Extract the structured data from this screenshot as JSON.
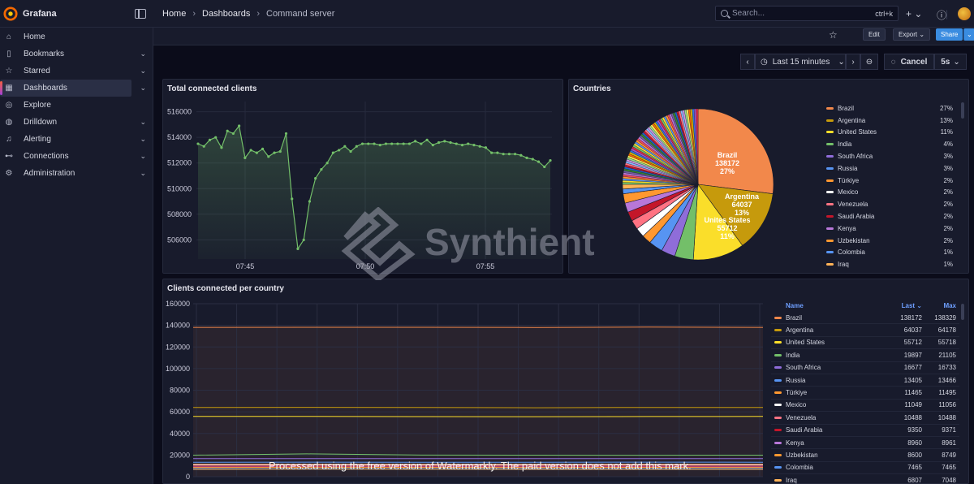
{
  "app": {
    "name": "Grafana"
  },
  "breadcrumb": [
    "Home",
    "Dashboards",
    "Command server"
  ],
  "search": {
    "placeholder": "Search...",
    "shortcut": "ctrl+k"
  },
  "sidebar": {
    "items": [
      {
        "label": "Home",
        "icon": "home-icon",
        "chevron": false
      },
      {
        "label": "Bookmarks",
        "icon": "bookmark-icon",
        "chevron": true
      },
      {
        "label": "Starred",
        "icon": "star-icon",
        "chevron": true
      },
      {
        "label": "Dashboards",
        "icon": "grid-icon",
        "chevron": true,
        "active": true
      },
      {
        "label": "Explore",
        "icon": "compass-icon",
        "chevron": false
      },
      {
        "label": "Drilldown",
        "icon": "drilldown-icon",
        "chevron": true
      },
      {
        "label": "Alerting",
        "icon": "bell-icon",
        "chevron": true
      },
      {
        "label": "Connections",
        "icon": "link-icon",
        "chevron": true
      },
      {
        "label": "Administration",
        "icon": "gear-icon",
        "chevron": true
      }
    ]
  },
  "toolbar": {
    "edit_label": "Edit",
    "export_label": "Export",
    "share_label": "Share"
  },
  "time": {
    "range_label": "Last 15 minutes",
    "cancel_label": "Cancel",
    "refresh_interval": "5s"
  },
  "panels": {
    "total": {
      "title": "Total connected clients"
    },
    "countries": {
      "title": "Countries"
    },
    "per_country": {
      "title": "Clients connected per country"
    }
  },
  "colors": {
    "accent": "#3a8ce0",
    "line_green": "#73bf69",
    "brazil": "#f2884b",
    "argentina": "#c69a0c",
    "united_states": "#fade2a"
  },
  "chart_data": [
    {
      "type": "line",
      "title": "Total connected clients",
      "x_ticks": [
        "07:45",
        "07:50",
        "07:55"
      ],
      "y_ticks": [
        506000,
        508000,
        510000,
        512000,
        514000,
        516000
      ],
      "ylim": [
        504500,
        516800
      ],
      "series": [
        {
          "values": [
            513500,
            513300,
            513800,
            514000,
            513200,
            514500,
            514300,
            514900,
            512400,
            513000,
            512800,
            513100,
            512500,
            512800,
            512900,
            514300,
            509200,
            505300,
            506000,
            509000,
            510800,
            511500,
            512000,
            512800,
            513000,
            513300,
            512900,
            513300,
            513500,
            513500,
            513500,
            513400,
            513500,
            513500,
            513500,
            513500,
            513500,
            513700,
            513500,
            513800,
            513400,
            513600,
            513700,
            513600,
            513500,
            513400,
            513500,
            513400,
            513300,
            513200,
            512800,
            512800,
            512700,
            512700,
            512700,
            512600,
            512400,
            512300,
            512100,
            511700,
            512200
          ]
        }
      ],
      "grid": true
    },
    {
      "type": "pie",
      "title": "Countries",
      "slice_labels": [
        {
          "name": "Brazil",
          "value": "138172",
          "pct": "27%"
        },
        {
          "name": "Argentina",
          "value": "64037",
          "pct": "13%"
        },
        {
          "name": "Unites States",
          "value": "55712",
          "pct": "11%"
        }
      ],
      "legend": [
        {
          "name": "Brazil",
          "pct": "27%",
          "color": "#f2884b"
        },
        {
          "name": "Argentina",
          "pct": "13%",
          "color": "#c69a0c"
        },
        {
          "name": "United States",
          "pct": "11%",
          "color": "#fade2a"
        },
        {
          "name": "India",
          "pct": "4%",
          "color": "#73bf69"
        },
        {
          "name": "South Africa",
          "pct": "3%",
          "color": "#8f6dd9"
        },
        {
          "name": "Russia",
          "pct": "3%",
          "color": "#5794f2"
        },
        {
          "name": "Türkiye",
          "pct": "2%",
          "color": "#ff9830"
        },
        {
          "name": "Mexico",
          "pct": "2%",
          "color": "#ffffff"
        },
        {
          "name": "Venezuela",
          "pct": "2%",
          "color": "#ff7383"
        },
        {
          "name": "Saudi Arabia",
          "pct": "2%",
          "color": "#c4162a"
        },
        {
          "name": "Kenya",
          "pct": "2%",
          "color": "#b877d9"
        },
        {
          "name": "Uzbekistan",
          "pct": "2%",
          "color": "#ff9830"
        },
        {
          "name": "Colombia",
          "pct": "1%",
          "color": "#5794f2"
        },
        {
          "name": "Iraq",
          "pct": "1%",
          "color": "#ffb357"
        }
      ],
      "legend_placement": "right"
    },
    {
      "type": "line",
      "title": "Clients connected per country",
      "y_ticks": [
        0,
        20000,
        40000,
        60000,
        80000,
        100000,
        120000,
        140000,
        160000
      ],
      "ylim": [
        0,
        160000
      ],
      "series": [
        {
          "name": "Brazil",
          "values": [
            138172,
            138200,
            138250,
            138100,
            138329,
            138172
          ],
          "color": "#f2884b"
        },
        {
          "name": "Argentina",
          "values": [
            64037,
            64178,
            64000,
            63800,
            64100,
            64037
          ],
          "color": "#c69a0c"
        },
        {
          "name": "United States",
          "values": [
            55712,
            55718,
            55600,
            55500,
            55650,
            55712
          ],
          "color": "#fade2a"
        },
        {
          "name": "India",
          "values": [
            19897,
            21105,
            20000,
            19900,
            19800,
            19897
          ],
          "color": "#73bf69"
        },
        {
          "name": "South Africa",
          "values": [
            16677,
            16733,
            16700,
            16650,
            16690,
            16677
          ],
          "color": "#8f6dd9"
        },
        {
          "name": "Russia",
          "values": [
            13405,
            13466,
            13400,
            13380,
            13420,
            13405
          ],
          "color": "#5794f2"
        },
        {
          "name": "Türkiye",
          "values": [
            11465,
            11495,
            11450,
            11440,
            11470,
            11465
          ],
          "color": "#ff9830"
        },
        {
          "name": "Mexico",
          "values": [
            11049,
            11056,
            11040,
            11030,
            11050,
            11049
          ],
          "color": "#ffffff"
        },
        {
          "name": "Venezuela",
          "values": [
            10488,
            10488,
            10470,
            10460,
            10480,
            10488
          ],
          "color": "#ff7383"
        },
        {
          "name": "Saudi Arabia",
          "values": [
            9350,
            9371,
            9340,
            9330,
            9360,
            9350
          ],
          "color": "#c4162a"
        },
        {
          "name": "Kenya",
          "values": [
            8960,
            8961,
            8950,
            8940,
            8955,
            8960
          ],
          "color": "#b877d9"
        },
        {
          "name": "Uzbekistan",
          "values": [
            8600,
            8749,
            8650,
            8600,
            8620,
            8600
          ],
          "color": "#ff9830"
        },
        {
          "name": "Colombia",
          "values": [
            7465,
            7465,
            7450,
            7440,
            7460,
            7465
          ],
          "color": "#5794f2"
        },
        {
          "name": "Iraq",
          "values": [
            6807,
            7048,
            6900,
            6850,
            6820,
            6807
          ],
          "color": "#ffb357"
        }
      ],
      "table": {
        "headers": [
          "Name",
          "Last",
          "Max"
        ],
        "rows": [
          [
            "Brazil",
            "138172",
            "138329"
          ],
          [
            "Argentina",
            "64037",
            "64178"
          ],
          [
            "United States",
            "55712",
            "55718"
          ],
          [
            "India",
            "19897",
            "21105"
          ],
          [
            "South Africa",
            "16677",
            "16733"
          ],
          [
            "Russia",
            "13405",
            "13466"
          ],
          [
            "Türkiye",
            "11465",
            "11495"
          ],
          [
            "Mexico",
            "11049",
            "11056"
          ],
          [
            "Venezuela",
            "10488",
            "10488"
          ],
          [
            "Saudi Arabia",
            "9350",
            "9371"
          ],
          [
            "Kenya",
            "8960",
            "8961"
          ],
          [
            "Uzbekistan",
            "8600",
            "8749"
          ],
          [
            "Colombia",
            "7465",
            "7465"
          ],
          [
            "Iraq",
            "6807",
            "7048"
          ]
        ]
      },
      "grid": true
    }
  ],
  "watermarks": {
    "logo_text": "Synthient",
    "footer_text": "Processed using the free version of Watermarkly. The paid version does not add this mark."
  }
}
